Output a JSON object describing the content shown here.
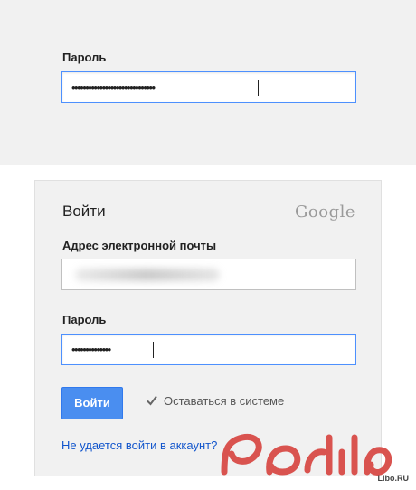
{
  "top_form": {
    "password_label": "Пароль",
    "password_value": "••••••••••••••••••••••••••••••"
  },
  "login": {
    "title": "Войти",
    "brand": "Google",
    "email_label": "Адрес электронной почты",
    "password_label": "Пароль",
    "password_value": "••••••••••••••",
    "signin_button": "Войти",
    "stay_signed_in": "Оставаться в системе",
    "stay_signed_in_checked": true,
    "help_link": "Не удается войти в аккаунт?"
  },
  "watermark": {
    "site": "Libo.RU"
  },
  "colors": {
    "panel_bg": "#f1f1f1",
    "focus_border": "#4d90fe",
    "button_blue": "#4a8ef0",
    "link_blue": "#1155cc",
    "watermark_red": "#d9534f"
  }
}
